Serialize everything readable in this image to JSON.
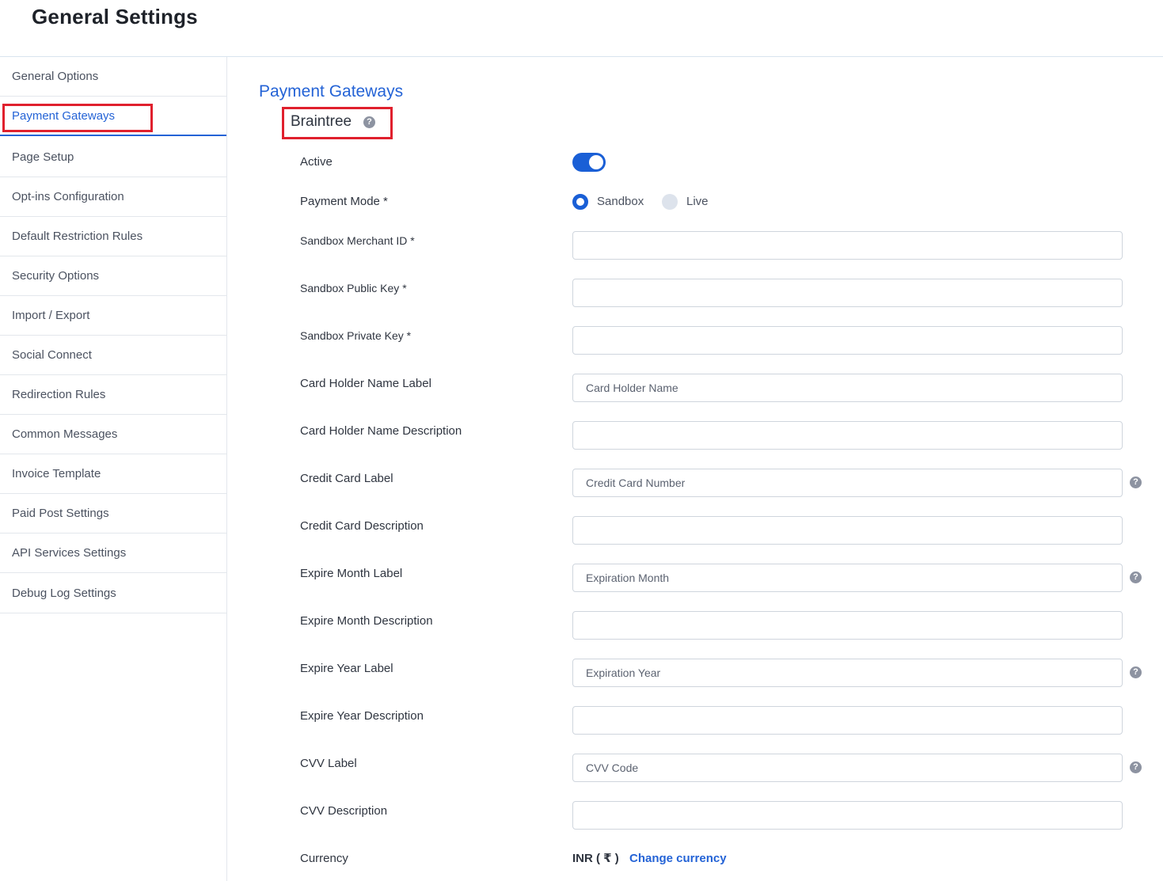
{
  "page": {
    "title": "General Settings"
  },
  "sidebar": {
    "items": [
      {
        "label": "General Options"
      },
      {
        "label": "Payment Gateways"
      },
      {
        "label": "Page Setup"
      },
      {
        "label": "Opt-ins Configuration"
      },
      {
        "label": "Default Restriction Rules"
      },
      {
        "label": "Security Options"
      },
      {
        "label": "Import / Export"
      },
      {
        "label": "Social Connect"
      },
      {
        "label": "Redirection Rules"
      },
      {
        "label": "Common Messages"
      },
      {
        "label": "Invoice Template"
      },
      {
        "label": "Paid Post Settings"
      },
      {
        "label": "API Services Settings"
      },
      {
        "label": "Debug Log Settings"
      }
    ],
    "active_item": "Payment Gateways"
  },
  "main": {
    "section_title": "Payment Gateways",
    "gateway_name": "Braintree",
    "help_glyph": "?",
    "active_label": "Active",
    "active_on": true,
    "payment_mode_label": "Payment Mode *",
    "payment_mode_options": [
      "Sandbox",
      "Live"
    ],
    "payment_mode_selected": "Sandbox",
    "fields": [
      {
        "label": "Sandbox Merchant ID *",
        "value": ""
      },
      {
        "label": "Sandbox Public Key *",
        "value": ""
      },
      {
        "label": "Sandbox Private Key *",
        "value": ""
      },
      {
        "label": "Card Holder Name Label",
        "value": "Card Holder Name"
      },
      {
        "label": "Card Holder Name Description",
        "value": ""
      },
      {
        "label": "Credit Card Label",
        "value": "Credit Card Number"
      },
      {
        "label": "Credit Card Description",
        "value": ""
      },
      {
        "label": "Expire Month Label",
        "value": "Expiration Month"
      },
      {
        "label": "Expire Month Description",
        "value": ""
      },
      {
        "label": "Expire Year Label",
        "value": "Expiration Year"
      },
      {
        "label": "Expire Year Description",
        "value": ""
      },
      {
        "label": "CVV Label",
        "value": "CVV Code"
      },
      {
        "label": "CVV Description",
        "value": ""
      }
    ],
    "currency_label": "Currency",
    "currency_value": "INR ( ₹ )",
    "change_currency_label": "Change currency"
  },
  "colors": {
    "accent": "#2463d6",
    "toggle_on": "#1a5fd6",
    "highlight_box": "#e0202d"
  }
}
